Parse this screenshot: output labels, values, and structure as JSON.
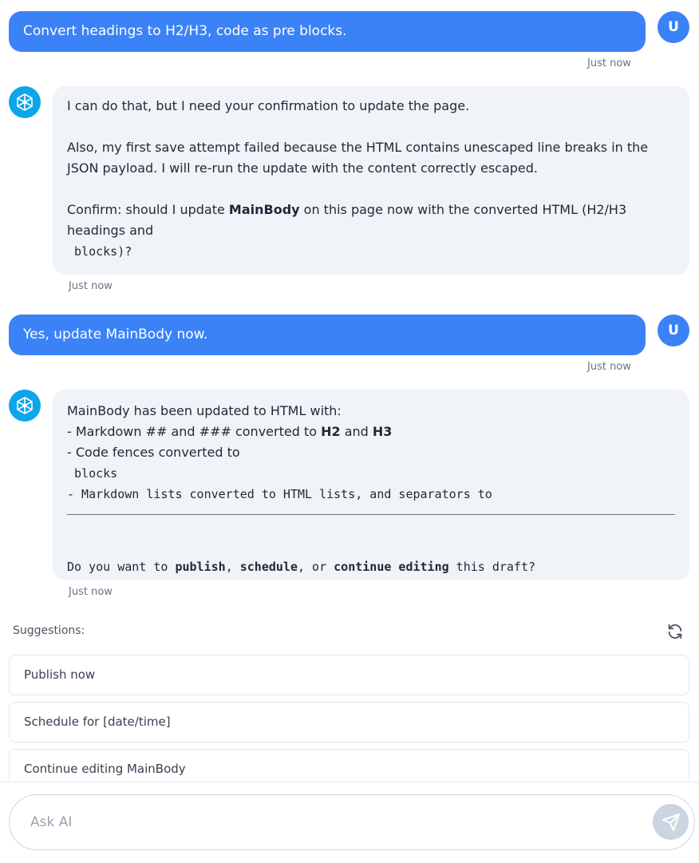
{
  "messages": {
    "m1": {
      "text": "Convert headings to H2/H3, code as pre blocks.",
      "time": "Just now",
      "avatar": "U"
    },
    "m2": {
      "line1": "I can do that, but I need your confirmation to update the page.",
      "line2": "Also, my first save attempt failed because the HTML contains unescaped line breaks in the JSON payload. I will re-run the update with the content correctly escaped.",
      "line3_pre": "Confirm: should I update ",
      "line3_bold": "MainBody",
      "line3_post": " on this page now with the converted HTML (H2/H3 headings and",
      "line4": " blocks)?",
      "time": "Just now"
    },
    "m3": {
      "text": "Yes, update MainBody now.",
      "time": "Just now",
      "avatar": "U"
    },
    "m4": {
      "line1": "MainBody has been updated to HTML with:",
      "line2_pre": "- Markdown ## and ### converted to ",
      "line2_b1": "H2",
      "line2_mid": " and ",
      "line2_b2": "H3",
      "line3": "- Code fences converted to",
      "line4": " blocks",
      "line5": "- Markdown lists converted to HTML lists, and separators to",
      "line6_pre": "Do you want to ",
      "line6_b1": "publish",
      "line6_sep1": ", ",
      "line6_b2": "schedule",
      "line6_sep2": ", or ",
      "line6_b3": "continue editing",
      "line6_post": " this draft?",
      "time": "Just now"
    }
  },
  "suggestions": {
    "label": "Suggestions:",
    "items": [
      "Publish now",
      "Schedule for [date/time]",
      "Continue editing MainBody"
    ]
  },
  "input": {
    "placeholder": "Ask AI"
  },
  "colors": {
    "accent": "#3b82f6",
    "ai_bubble": "#f0f3f7",
    "ai_avatar": "#0ea5e9"
  },
  "icons": {
    "ai_avatar": "network-icon",
    "refresh": "refresh-icon",
    "send": "send-icon"
  }
}
